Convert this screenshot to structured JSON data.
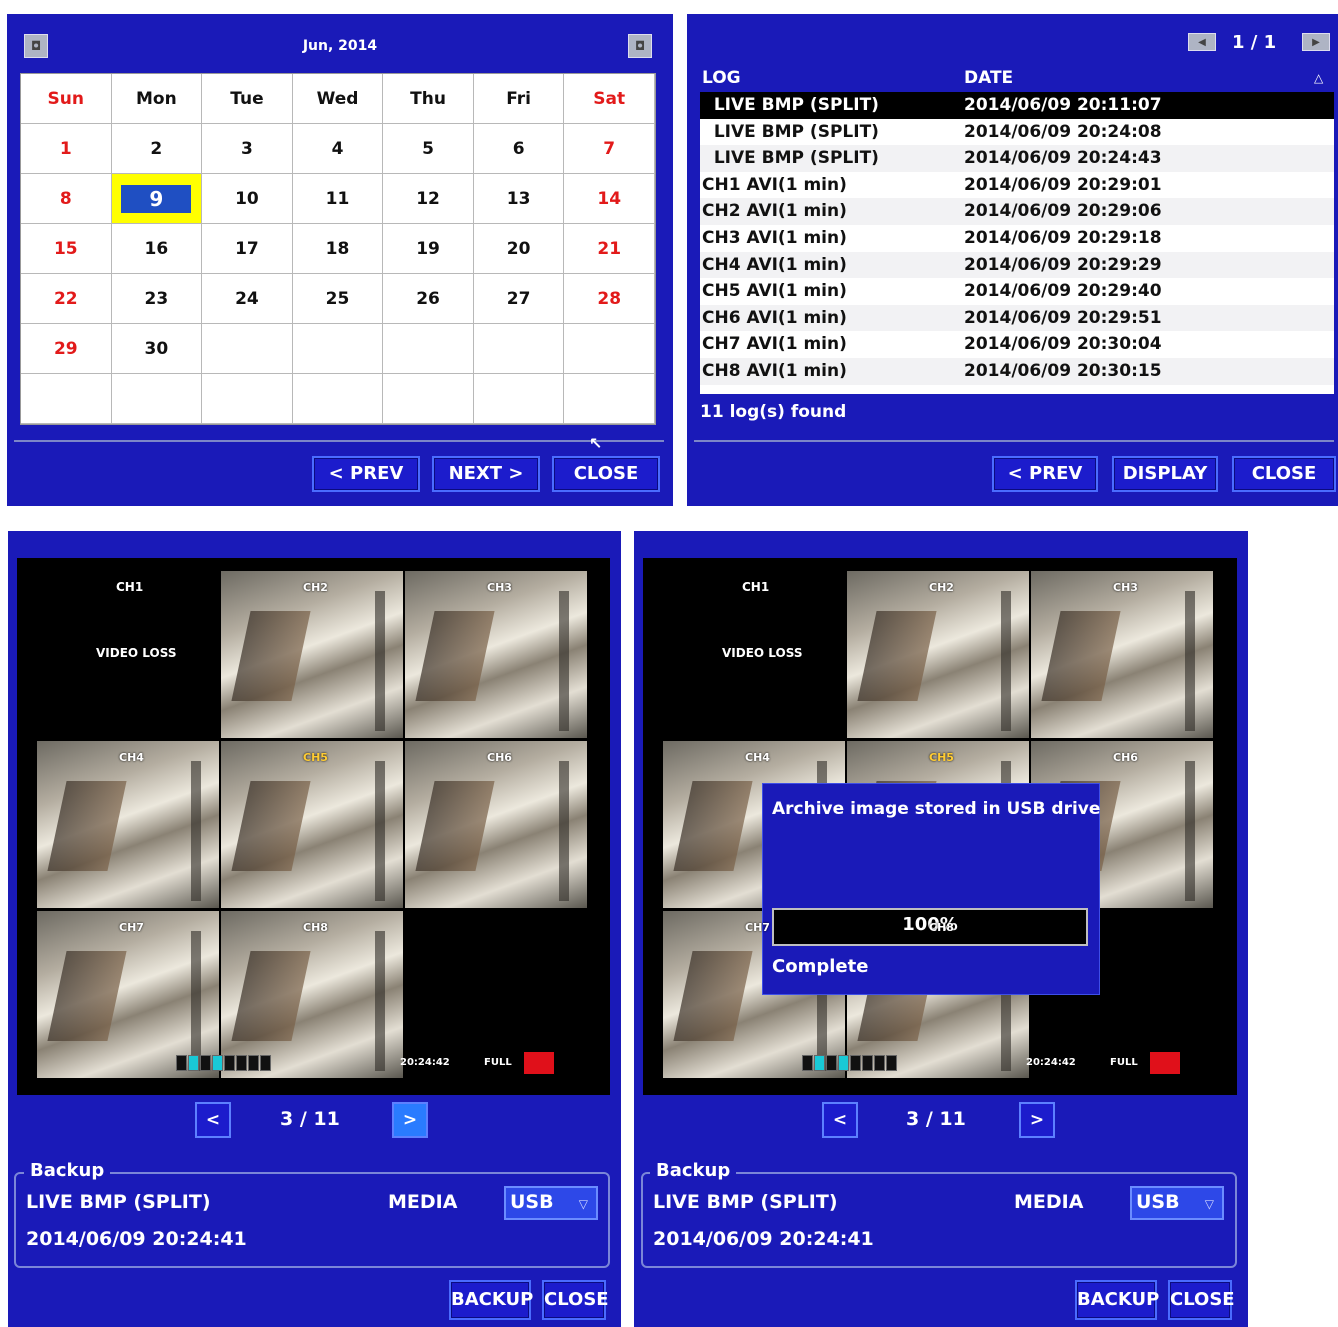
{
  "calendar": {
    "month_title": "Jun, 2014",
    "prev_icon": "gear-icon",
    "weekdays": [
      "Sun",
      "Mon",
      "Tue",
      "Wed",
      "Thu",
      "Fri",
      "Sat"
    ],
    "weeks": [
      [
        "1",
        "2",
        "3",
        "4",
        "5",
        "6",
        "7"
      ],
      [
        "8",
        "9",
        "10",
        "11",
        "12",
        "13",
        "14"
      ],
      [
        "15",
        "16",
        "17",
        "18",
        "19",
        "20",
        "21"
      ],
      [
        "22",
        "23",
        "24",
        "25",
        "26",
        "27",
        "28"
      ],
      [
        "29",
        "30",
        "",
        "",
        "",
        "",
        ""
      ],
      [
        "",
        "",
        "",
        "",
        "",
        "",
        ""
      ]
    ],
    "selected_day": "9",
    "buttons": {
      "prev": "< PREV",
      "next": "NEXT >",
      "close": "CLOSE"
    }
  },
  "log_list": {
    "page": "1 / 1",
    "headers": {
      "log": "LOG",
      "date": "DATE"
    },
    "rows": [
      {
        "log": "  LIVE BMP (SPLIT)",
        "date": "2014/06/09 20:11:07"
      },
      {
        "log": "  LIVE BMP (SPLIT)",
        "date": "2014/06/09 20:24:08"
      },
      {
        "log": "  LIVE BMP (SPLIT)",
        "date": "2014/06/09 20:24:43"
      },
      {
        "log": "CH1 AVI(1 min)",
        "date": "2014/06/09 20:29:01"
      },
      {
        "log": "CH2 AVI(1 min)",
        "date": "2014/06/09 20:29:06"
      },
      {
        "log": "CH3 AVI(1 min)",
        "date": "2014/06/09 20:29:18"
      },
      {
        "log": "CH4 AVI(1 min)",
        "date": "2014/06/09 20:29:29"
      },
      {
        "log": "CH5 AVI(1 min)",
        "date": "2014/06/09 20:29:40"
      },
      {
        "log": "CH6 AVI(1 min)",
        "date": "2014/06/09 20:29:51"
      },
      {
        "log": "CH7 AVI(1 min)",
        "date": "2014/06/09 20:30:04"
      },
      {
        "log": "CH8 AVI(1 min)",
        "date": "2014/06/09 20:30:15"
      }
    ],
    "found": "11 log(s) found",
    "buttons": {
      "prev": "< PREV",
      "display": "DISPLAY",
      "close": "CLOSE"
    }
  },
  "backup_left": {
    "ch1": "CH1",
    "video_loss": "VIDEO LOSS",
    "tiles": [
      "CH2",
      "CH3",
      "CH4",
      "CH5",
      "CH6",
      "CH7",
      "CH8"
    ],
    "status_time": "20:24:42",
    "status_full": "FULL",
    "page": "3 / 11",
    "legend": "Backup",
    "item": "LIVE BMP (SPLIT)",
    "media_label": "MEDIA",
    "media_value": "USB",
    "datetime": "2014/06/09 20:24:41",
    "buttons": {
      "backup": "BACKUP",
      "close": "CLOSE"
    }
  },
  "backup_right": {
    "ch1": "CH1",
    "video_loss": "VIDEO LOSS",
    "popup_title": "Archive image stored in USB drive",
    "progress": "100%",
    "progress_fraction": 1.0,
    "status": "Complete",
    "page": "3 / 11",
    "legend": "Backup",
    "item": "LIVE BMP (SPLIT)",
    "media_label": "MEDIA",
    "media_value": "USB",
    "datetime": "2014/06/09 20:24:41",
    "buttons": {
      "backup": "BACKUP",
      "close": "CLOSE"
    }
  }
}
